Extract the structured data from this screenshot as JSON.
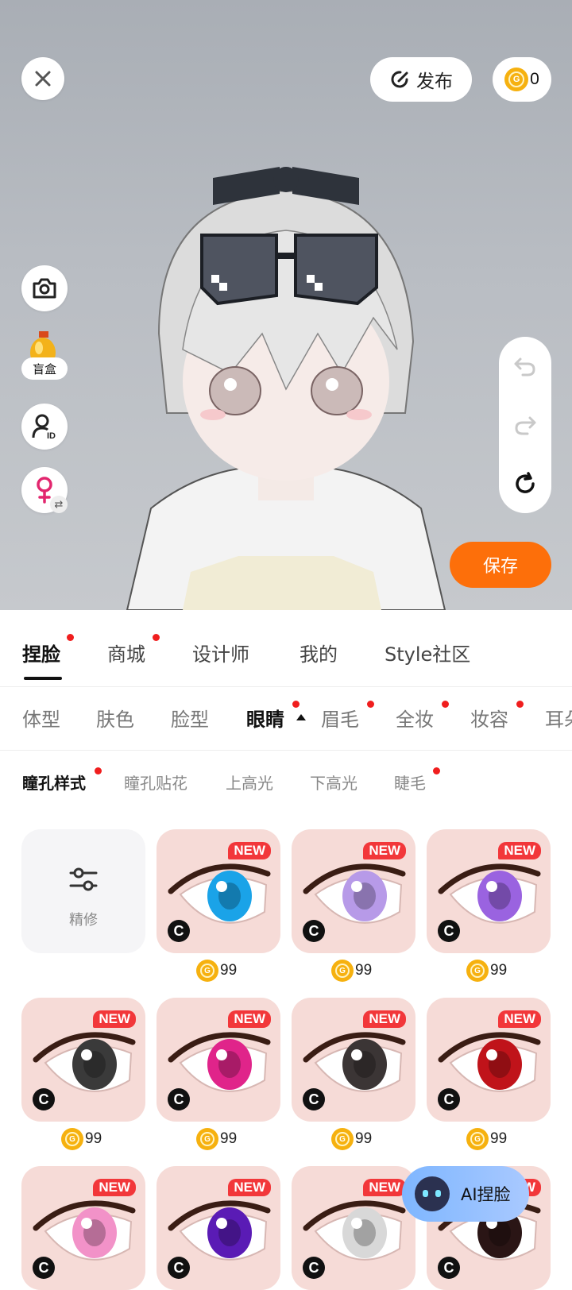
{
  "top": {
    "publish_label": "发布",
    "coin_count": "0",
    "save_label": "保存"
  },
  "side": {
    "blindbox_label": "盲盒"
  },
  "main_tabs": [
    {
      "label": "捏脸",
      "active": true,
      "dot": true
    },
    {
      "label": "商城",
      "active": false,
      "dot": true
    },
    {
      "label": "设计师",
      "active": false,
      "dot": false
    },
    {
      "label": "我的",
      "active": false,
      "dot": false
    },
    {
      "label": "Style社区",
      "active": false,
      "dot": false
    }
  ],
  "sub_tabs": [
    {
      "label": "体型"
    },
    {
      "label": "肤色"
    },
    {
      "label": "脸型"
    },
    {
      "label": "眼睛",
      "active": true
    },
    {
      "label": "眉毛"
    },
    {
      "label": "全妆"
    },
    {
      "label": "妆容"
    },
    {
      "label": "耳朵"
    }
  ],
  "third_tabs": [
    {
      "label": "瞳孔样式",
      "active": true
    },
    {
      "label": "瞳孔贴花"
    },
    {
      "label": "上高光"
    },
    {
      "label": "下高光"
    },
    {
      "label": "睫毛"
    }
  ],
  "grid": {
    "refine_label": "精修",
    "new_label": "NEW",
    "copyright_mark": "C",
    "coin_mark": "G",
    "prices": [
      "99",
      "99",
      "99",
      "99",
      "99",
      "99",
      "99"
    ],
    "iris_colors": [
      "#1aa3e8",
      "#b79ae8",
      "#9a63e0",
      "#3a3a3a",
      "#e0248a",
      "#3b3535",
      "#c0131a",
      "#f292c8",
      "#5a1bb5",
      "#d8d8d8",
      "#2a1515"
    ]
  },
  "ai_button": {
    "label": "AI捏脸"
  },
  "colors": {
    "accent": "#fd6f0a",
    "coin": "#f6b10f",
    "badge": "#f2373a"
  }
}
